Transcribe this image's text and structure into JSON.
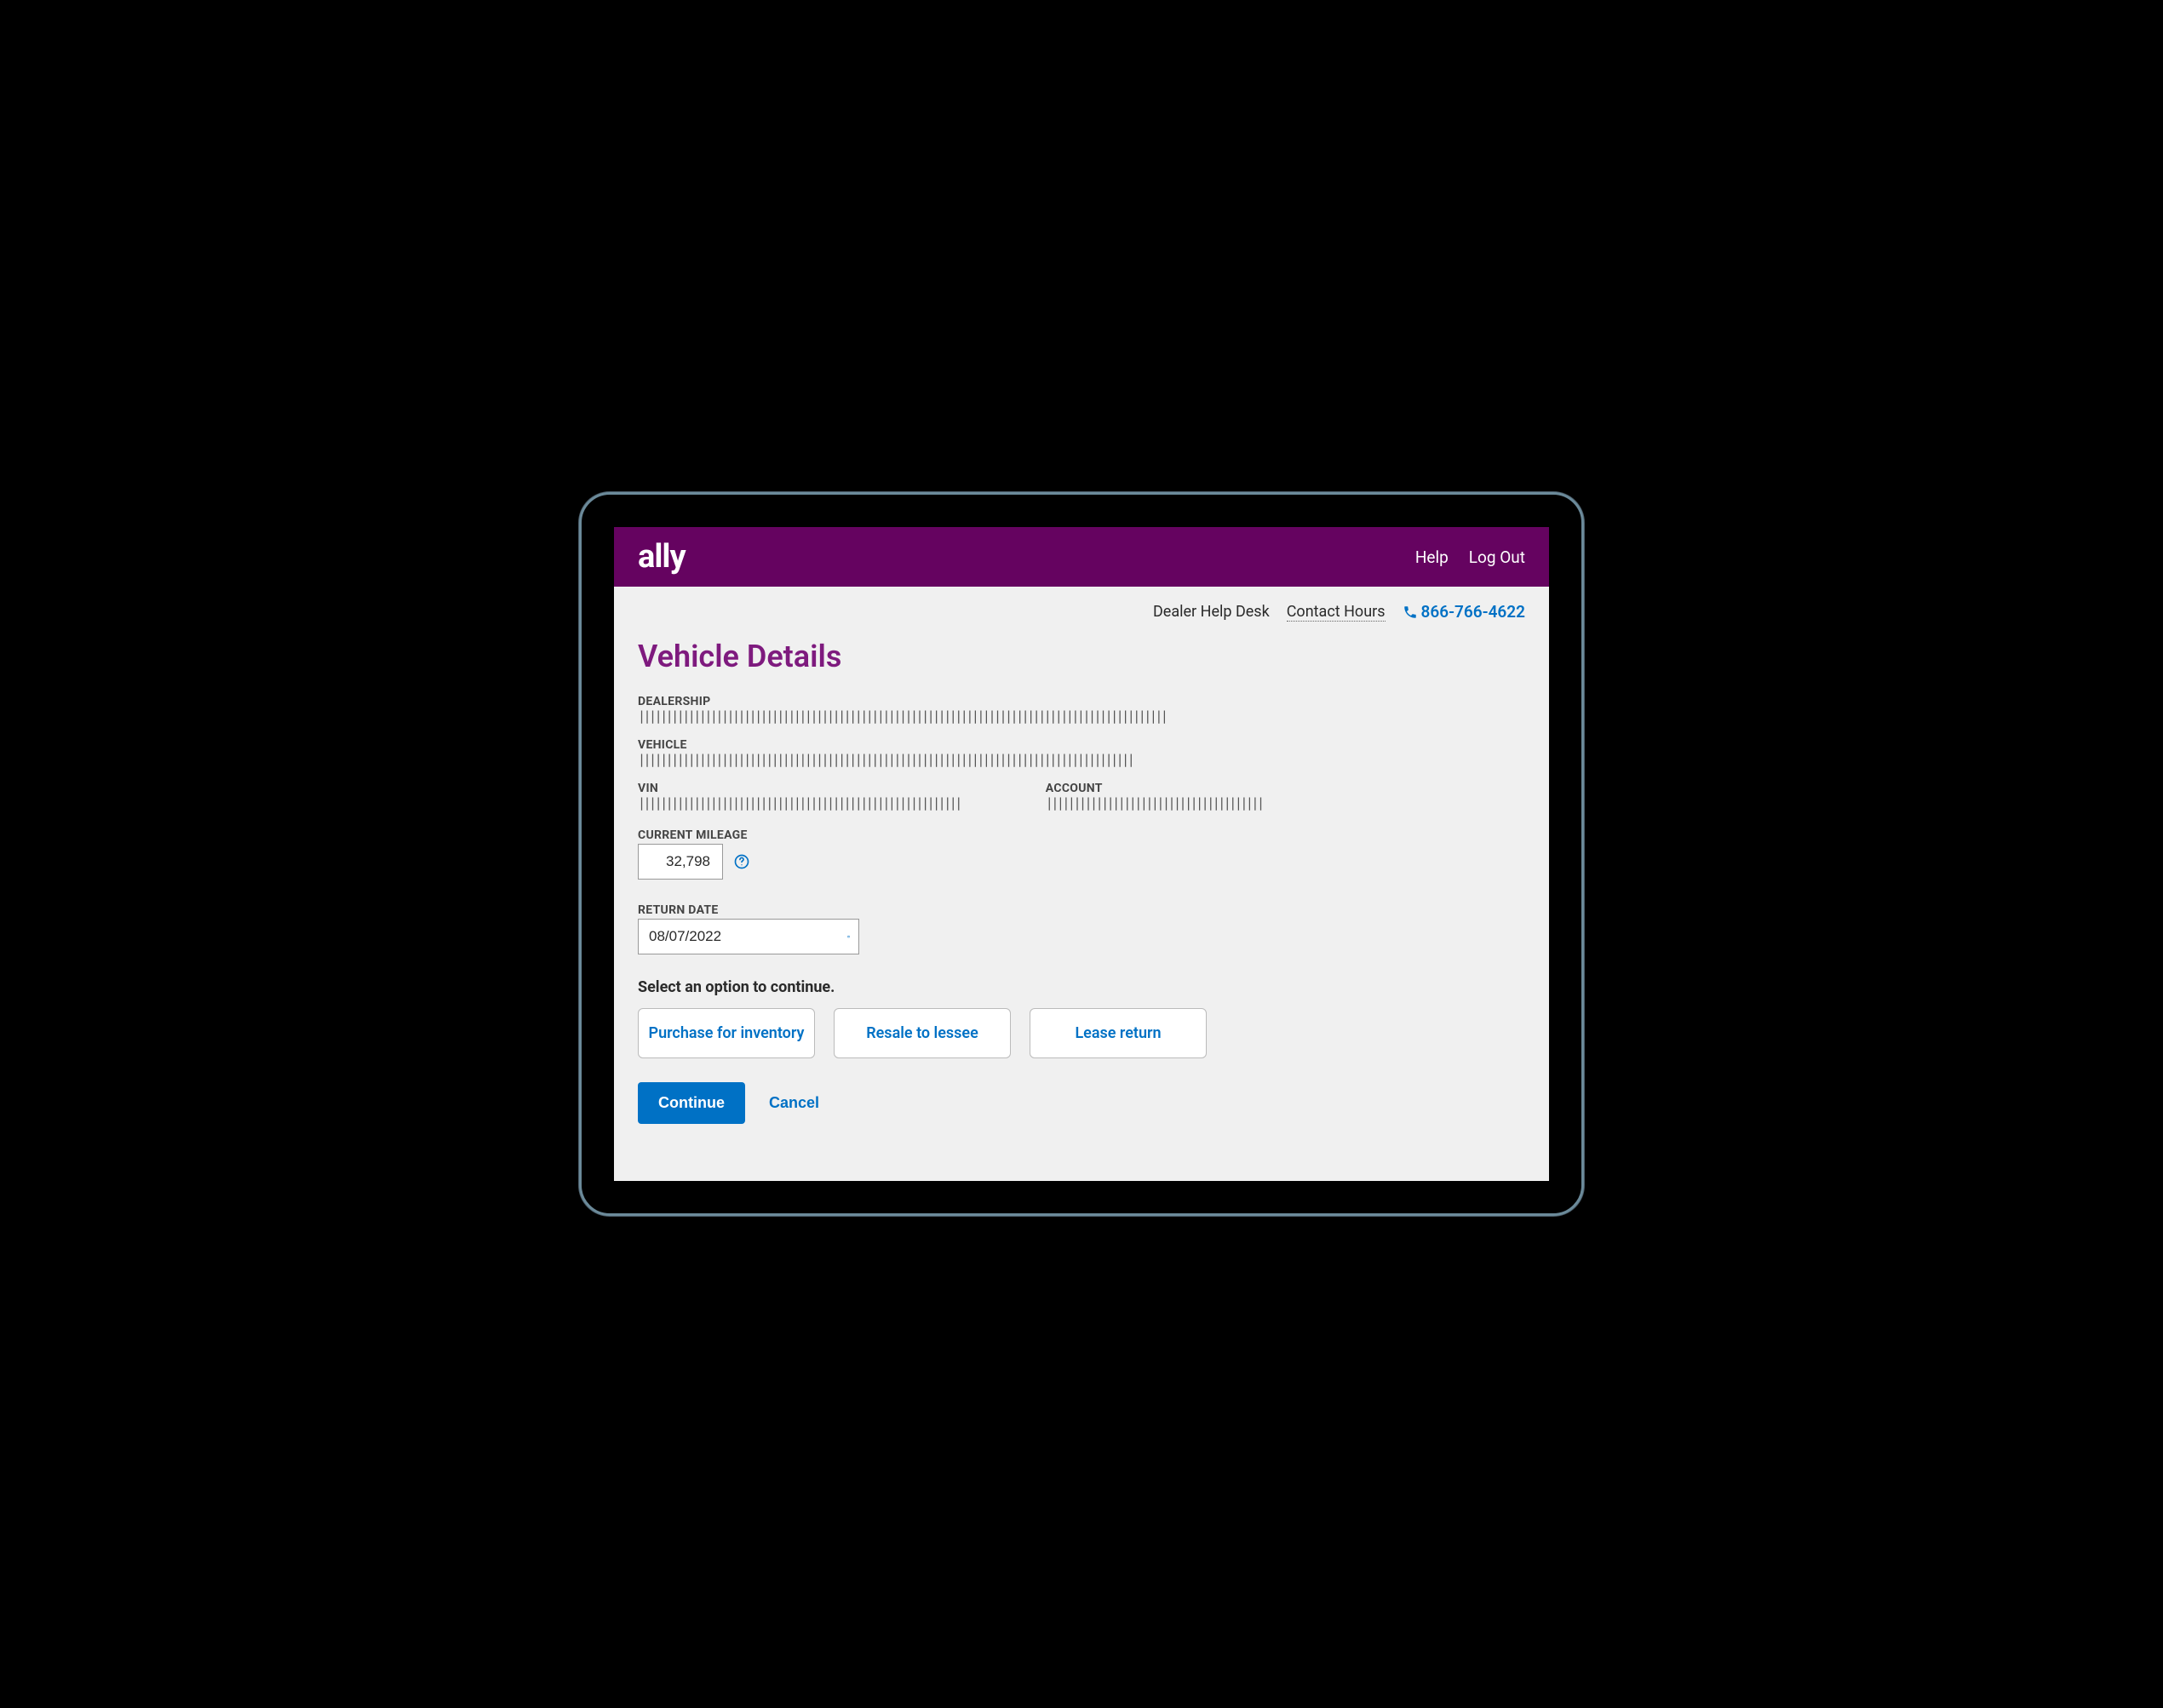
{
  "header": {
    "logo": "ally",
    "help": "Help",
    "logout": "Log Out"
  },
  "subheader": {
    "dealerHelp": "Dealer Help Desk",
    "contactHours": "Contact Hours",
    "phone": "866-766-4622"
  },
  "page": {
    "title": "Vehicle Details"
  },
  "fields": {
    "dealership": {
      "label": "DEALERSHIP",
      "value": "|||||||||||||||||||||||||||||||||||||||||||||||||||||||||||||||||||||||||||||||||||||||||||||||"
    },
    "vehicle": {
      "label": "VEHICLE",
      "value": "|||||||||||||||||||||||||||||||||||||||||||||||||||||||||||||||||||||||||||||||||||||||||"
    },
    "vin": {
      "label": "VIN",
      "value": "||||||||||||||||||||||||||||||||||||||||||||||||||||||||||"
    },
    "account": {
      "label": "ACCOUNT",
      "value": "|||||||||||||||||||||||||||||||||||||||"
    },
    "mileage": {
      "label": "CURRENT MILEAGE",
      "value": "32,798"
    },
    "returnDate": {
      "label": "RETURN DATE",
      "value": "08/07/2022"
    }
  },
  "prompt": "Select an option to continue.",
  "options": {
    "purchase": "Purchase for inventory",
    "resale": "Resale to lessee",
    "leaseReturn": "Lease return"
  },
  "actions": {
    "continue": "Continue",
    "cancel": "Cancel"
  }
}
